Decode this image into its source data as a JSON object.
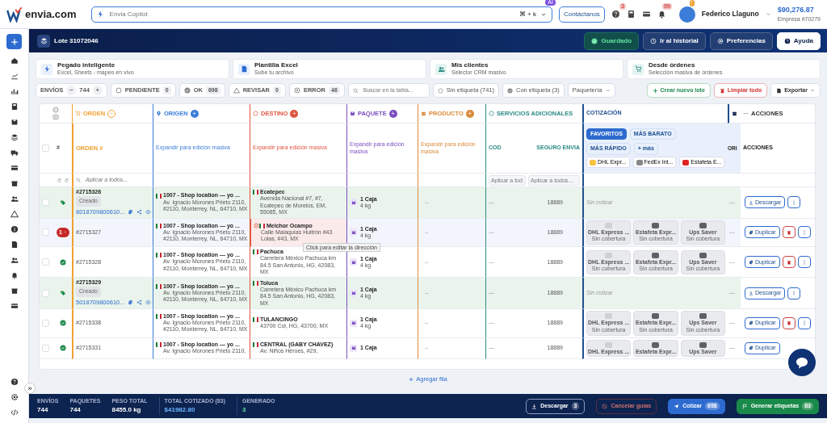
{
  "brand": {
    "name": "envia.com"
  },
  "search": {
    "placeholder": "Envia Copilot",
    "shortcut": "⌘ + k",
    "badge": "AI"
  },
  "contact_button": "Contáctanos",
  "header_icons": [
    {
      "kind": "help",
      "badge": "3"
    },
    {
      "kind": "calculator"
    },
    {
      "kind": "card"
    },
    {
      "kind": "bell",
      "badge": "99"
    }
  ],
  "user": {
    "name": "Federico Llaguno",
    "balance": "$90,276.87",
    "company": "Empresa #70279",
    "badge": "!"
  },
  "collapse_toggle": "»",
  "lote": {
    "title": "Lote 31072046"
  },
  "header_buttons": [
    {
      "kind": "saved",
      "label": "Guardado"
    },
    {
      "kind": "history",
      "label": "Ir al historial"
    },
    {
      "kind": "prefs",
      "label": "Preferencias"
    },
    {
      "kind": "help",
      "label": "Ayuda"
    }
  ],
  "import_options": [
    {
      "kind": "paste",
      "title": "Pegado inteligente",
      "subtitle": "Excel, Sheets - mapeo en vivo"
    },
    {
      "kind": "excel",
      "title": "Plantilla Excel",
      "subtitle": "Sube tu archivo"
    },
    {
      "kind": "clients",
      "title": "Mis clientes",
      "subtitle": "Selector CRM masivo"
    },
    {
      "kind": "orders",
      "title": "Desde órdenes",
      "subtitle": "Selección masiva de órdenes"
    }
  ],
  "toolbar": {
    "counter_label": "ENVÍOS",
    "counter_minus": "−",
    "counter_value": "744",
    "counter_plus": "+",
    "filters": [
      {
        "kind": "pending",
        "label": "PENDIENTE",
        "count": "0"
      },
      {
        "kind": "ok",
        "label": "OK",
        "count": "698"
      },
      {
        "kind": "review",
        "label": "REVISAR",
        "count": "0"
      },
      {
        "kind": "error",
        "label": "ERROR",
        "count": "46"
      }
    ],
    "search_placeholder": "Buscar en la tabla...",
    "label_filters": [
      {
        "kind": "without",
        "label": "Sin etiqueta (741)"
      },
      {
        "kind": "with",
        "label": "Con etiqueta (3)"
      }
    ],
    "carrier_dropdown": "Paquetería",
    "actions": [
      {
        "kind": "create",
        "label": "Crear nuevo lote"
      },
      {
        "kind": "clear",
        "label": "Limpiar todo"
      },
      {
        "kind": "export",
        "label": "Exportar"
      }
    ]
  },
  "table": {
    "groups": [
      {
        "kind": "order",
        "label": "ORDEN",
        "color": "#f0a030",
        "toggle": "−"
      },
      {
        "kind": "origin",
        "label": "ORIGEN",
        "color": "#3b7dd8",
        "toggle": "+"
      },
      {
        "kind": "destination",
        "label": "DESTINO",
        "color": "#e0533d",
        "toggle": "+"
      },
      {
        "kind": "package",
        "label": "PAQUETE",
        "color": "#7a4fc0",
        "toggle": "+"
      },
      {
        "kind": "product",
        "label": "PRODUCTO",
        "color": "#d98a3a",
        "toggle": "+"
      },
      {
        "kind": "services",
        "label": "SERVICIOS ADICIONALES",
        "color": "#2b8a84"
      },
      {
        "kind": "quote",
        "label": "COTIZACIÓN",
        "color": "#1f4f8f"
      }
    ],
    "actions_header": "ACCIONES",
    "narrow_header": "ORI",
    "number_header": "#",
    "order_sub": "ORDEN #",
    "select_all_checked": false,
    "expand_hint": [
      "Expandir para edición masiva",
      "Expandir para edición masiva",
      "Expandir para edición masiva",
      "Expandir para edición masiva"
    ],
    "services_sub": [
      "COD",
      "SEGURO ENVIA"
    ],
    "quote_chips": [
      {
        "label": "FAVORITOS",
        "selected": true
      },
      {
        "label": "MÁS BARATO",
        "selected": false
      },
      {
        "label": "MÁS RÁPIDO",
        "selected": false
      },
      {
        "label": "+ más",
        "selected": false
      }
    ],
    "quote_carriers": [
      {
        "kind": "dhl",
        "label": "DHL Expr..."
      },
      {
        "kind": "fedex",
        "label": "FedEx Int..."
      },
      {
        "kind": "estafeta",
        "label": "Estafeta E..."
      }
    ],
    "actions_sub": "ACCIONES",
    "apply_placeholders": [
      "Aplicar a todos...",
      "Aplicar a tod",
      "Aplicar a todos..."
    ],
    "rows": [
      {
        "kind": "created",
        "checked": false,
        "order": "#2715326",
        "badge": "Creado",
        "tracking": "8018709800610...",
        "origin": {
          "title": "1007 - Shop location — yo ...",
          "lines": [
            "Av. Ignacio Morones Prieto 2110,",
            "#2110, Monterrey, NL, 64710, MX"
          ]
        },
        "destination": {
          "error": false,
          "title": "Ecatepec",
          "lines": [
            "Avenida Nacional #7, #7,",
            "Ecatepec de Morelos, EM,",
            "55085, MX"
          ]
        },
        "package": {
          "title": "1 Caja",
          "weight": "4 kg"
        },
        "product": "--",
        "cod": "—",
        "insurance": "18889",
        "quote": {
          "kind": "none",
          "text": "Sin cotizar"
        },
        "extra": "—",
        "actions": [
          {
            "kind": "download",
            "label": "Descargar"
          },
          {
            "kind": "more"
          }
        ]
      },
      {
        "kind": "error",
        "checked": false,
        "status_count": "1",
        "order": "#2715327",
        "origin": {
          "title": "1007 - Shop location — yo ...",
          "lines": [
            "Av. Ignacio Morones Prieto 2110,",
            "#2110, Monterrey, NL, 64710, MX"
          ]
        },
        "destination": {
          "error": true,
          "title": "Melchor Ocampo",
          "lines": [
            "Calle Malaquías Huitrón #43",
            "Lolas, #43, MX"
          ],
          "tooltip": "Click para editar la dirección"
        },
        "package": {
          "title": "1 Caja",
          "weight": "4 kg"
        },
        "product": "--",
        "cod": "—",
        "insurance": "18889",
        "quote": {
          "kind": "carriers",
          "carriers": [
            {
              "name": "DHL Express ...",
              "coverage": "Sin cobertura"
            },
            {
              "name": "Estafeta Expr...",
              "coverage": "Sin cobertura"
            },
            {
              "name": "Ups Saver",
              "coverage": "Sin cobertura"
            }
          ]
        },
        "extra": "—",
        "actions": [
          {
            "kind": "duplicate",
            "label": "Duplicar"
          },
          {
            "kind": "delete"
          },
          {
            "kind": "more"
          }
        ]
      },
      {
        "kind": "ok",
        "checked": false,
        "order": "#2715328",
        "origin": {
          "title": "1007 - Shop location — yo ...",
          "lines": [
            "Av. Ignacio Morones Prieto 2110,",
            "#2110, Monterrey, NL, 64710, MX"
          ]
        },
        "destination": {
          "error": false,
          "title": "Pachuca",
          "lines": [
            "Carretera México Pachuca km",
            "84.5 San Antonio, HG, 42083,",
            "MX"
          ]
        },
        "package": {
          "title": "1 Caja",
          "weight": "4 kg"
        },
        "product": "--",
        "cod": "—",
        "insurance": "18889",
        "quote": {
          "kind": "carriers",
          "carriers": [
            {
              "name": "DHL Express ...",
              "coverage": "Sin cobertura"
            },
            {
              "name": "Estafeta Expr...",
              "coverage": "Sin cobertura"
            },
            {
              "name": "Ups Saver",
              "coverage": "Sin cobertura"
            }
          ]
        },
        "extra": "—",
        "actions": [
          {
            "kind": "duplicate",
            "label": "Duplicar"
          },
          {
            "kind": "delete"
          },
          {
            "kind": "more"
          }
        ]
      },
      {
        "kind": "created",
        "checked": false,
        "order": "#2715329",
        "badge": "Creado",
        "tracking": "5018709800610...",
        "origin": {
          "title": "1007 - Shop location — yo ...",
          "lines": [
            "Av. Ignacio Morones Prieto 2110,",
            "#2110, Monterrey, NL, 64710, MX"
          ]
        },
        "destination": {
          "error": false,
          "title": "Toluca",
          "lines": [
            "Carretera México Pachuca km",
            "84.5 San Antonio, HG, 42083,",
            "MX"
          ]
        },
        "package": {
          "title": "1 Caja",
          "weight": "4 kg"
        },
        "product": "--",
        "cod": "—",
        "insurance": "18889",
        "quote": {
          "kind": "none",
          "text": "Sin cotizar"
        },
        "extra": "—",
        "actions": [
          {
            "kind": "download",
            "label": "Descargar"
          },
          {
            "kind": "more"
          }
        ]
      },
      {
        "kind": "ok",
        "checked": false,
        "order": "#2715338",
        "origin": {
          "title": "1007 - Shop location — yo ...",
          "lines": [
            "Av. Ignacio Morones Prieto 2110,",
            "#2110, Monterrey, NL, 64710, MX"
          ]
        },
        "destination": {
          "error": false,
          "title": "TULANCINGO",
          "lines": [
            "43700 Col, HG, 43700, MX"
          ]
        },
        "package": {
          "title": "1 Caja",
          "weight": "4 kg"
        },
        "product": "--",
        "cod": "—",
        "insurance": "18889",
        "quote": {
          "kind": "carriers",
          "carriers": [
            {
              "name": "DHL Express ...",
              "coverage": "Sin cobertura"
            },
            {
              "name": "Estafeta Expr...",
              "coverage": "Sin cobertura"
            },
            {
              "name": "Ups Saver",
              "coverage": "Sin cobertura"
            }
          ]
        },
        "extra": "—",
        "actions": [
          {
            "kind": "duplicate",
            "label": "Duplicar"
          },
          {
            "kind": "delete"
          },
          {
            "kind": "more"
          }
        ]
      },
      {
        "kind": "ok",
        "checked": false,
        "order": "#2715331",
        "origin": {
          "title": "1007 - Shop location — yo ...",
          "lines": [
            "Av. Ignacio Morones Prieto 2110,"
          ]
        },
        "destination": {
          "error": false,
          "title": "CENTRAL (GABY CHAVEZ)",
          "lines": [
            "Av. Niños Héroes, #29,"
          ]
        },
        "package": {
          "title": "1 Caja"
        },
        "product": "--",
        "cod": "—",
        "insurance": "18889",
        "quote": {
          "kind": "carriers",
          "carriers": [
            {
              "name": "DHL Express ..."
            },
            {
              "name": "Estafeta Expr..."
            },
            {
              "name": "Ups Saver"
            }
          ]
        },
        "extra": "—",
        "actions": [
          {
            "kind": "duplicate",
            "label": "Duplicar"
          }
        ]
      }
    ]
  },
  "add_row": "Agregar fila",
  "summary": {
    "stats": [
      {
        "kind": "plain",
        "label": "ENVÍOS",
        "value": "744"
      },
      {
        "kind": "plain",
        "label": "PAQUETES",
        "value": "744"
      },
      {
        "kind": "plain",
        "label": "PESO TOTAL",
        "value": "8455.0 kg"
      },
      {
        "kind": "money",
        "label": "TOTAL COTIZADO (83)",
        "value": "$41982.80"
      },
      {
        "kind": "success",
        "label": "GENERADO",
        "value": "3"
      }
    ],
    "buttons": [
      {
        "kind": "download",
        "label": "Descargar",
        "count": "3",
        "disabled": false
      },
      {
        "kind": "cancel",
        "label": "Cancelar guías",
        "disabled": true
      },
      {
        "kind": "quote",
        "label": "Cotizar",
        "count": "658",
        "disabled": false
      },
      {
        "kind": "labels",
        "label": "Generar etiquetas",
        "count": "83",
        "disabled": false
      }
    ]
  }
}
